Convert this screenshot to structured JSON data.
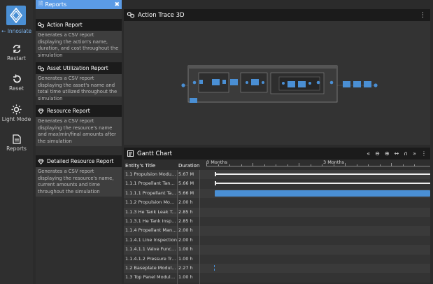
{
  "nav": {
    "back_label": "Innoslate",
    "items": [
      {
        "label": "Restart",
        "icon": "restart-icon"
      },
      {
        "label": "Reset",
        "icon": "reset-icon"
      },
      {
        "label": "Light Mode",
        "icon": "light-mode-icon"
      },
      {
        "label": "Reports",
        "icon": "reports-icon"
      }
    ]
  },
  "reports": {
    "title": "Reports",
    "cards": [
      {
        "title": "Action Report",
        "desc": "Generates a CSV report displaying the action's name, duration, and cost throughout the simulation"
      },
      {
        "title": "Asset Utilization Report",
        "desc": "Generates a CSV report displaying the asset's name and total time utilized throughout the simulation"
      },
      {
        "title": "Resource Report",
        "desc": "Generates a CSV report displaying the resource's name and max/min/final amounts after the simulation"
      },
      {
        "title": "Detailed Resource Report",
        "desc": "Generates a CSV report displaying the resource's name, current amounts and time throughout the simulation"
      }
    ]
  },
  "trace": {
    "title": "Action Trace 3D"
  },
  "gantt": {
    "title": "Gantt Chart",
    "col_title": "Entity's Title",
    "col_duration": "Duration",
    "timeline_labels": [
      "0 Months",
      "3 Months"
    ],
    "rows": [
      {
        "title": "1.1 Propulsion Module Ac...",
        "duration": "5.67 M"
      },
      {
        "title": "1.1.1 Propellant Tank Le...",
        "duration": "5.66 M"
      },
      {
        "title": "1.1.1.1 Propellant Tank...",
        "duration": "5.66 M"
      },
      {
        "title": "1.1.2 Propulsion Module...",
        "duration": "2.00 h"
      },
      {
        "title": "1.1.3 He Tank Leak Test",
        "duration": "2.85 h"
      },
      {
        "title": "1.1.3.1 He Tank Inspection",
        "duration": "2.85 h"
      },
      {
        "title": "1.1.4 Propellant Managem...",
        "duration": "2.00 h"
      },
      {
        "title": "1.1.4.1 Line Inspection",
        "duration": "2.00 h"
      },
      {
        "title": "1.1.4.1.1 Valve Function...",
        "duration": "1.00 h"
      },
      {
        "title": "1.1.4.1.2 Pressure Trans...",
        "duration": "1.00 h"
      },
      {
        "title": "1.2 Baseplate Module Acc...",
        "duration": "2.27 h"
      },
      {
        "title": "1.3 Top Panel Module Acc...",
        "duration": "1.00 h"
      }
    ]
  },
  "colors": {
    "accent": "#5b9be6",
    "bar_blue": "#4a8fd4"
  }
}
